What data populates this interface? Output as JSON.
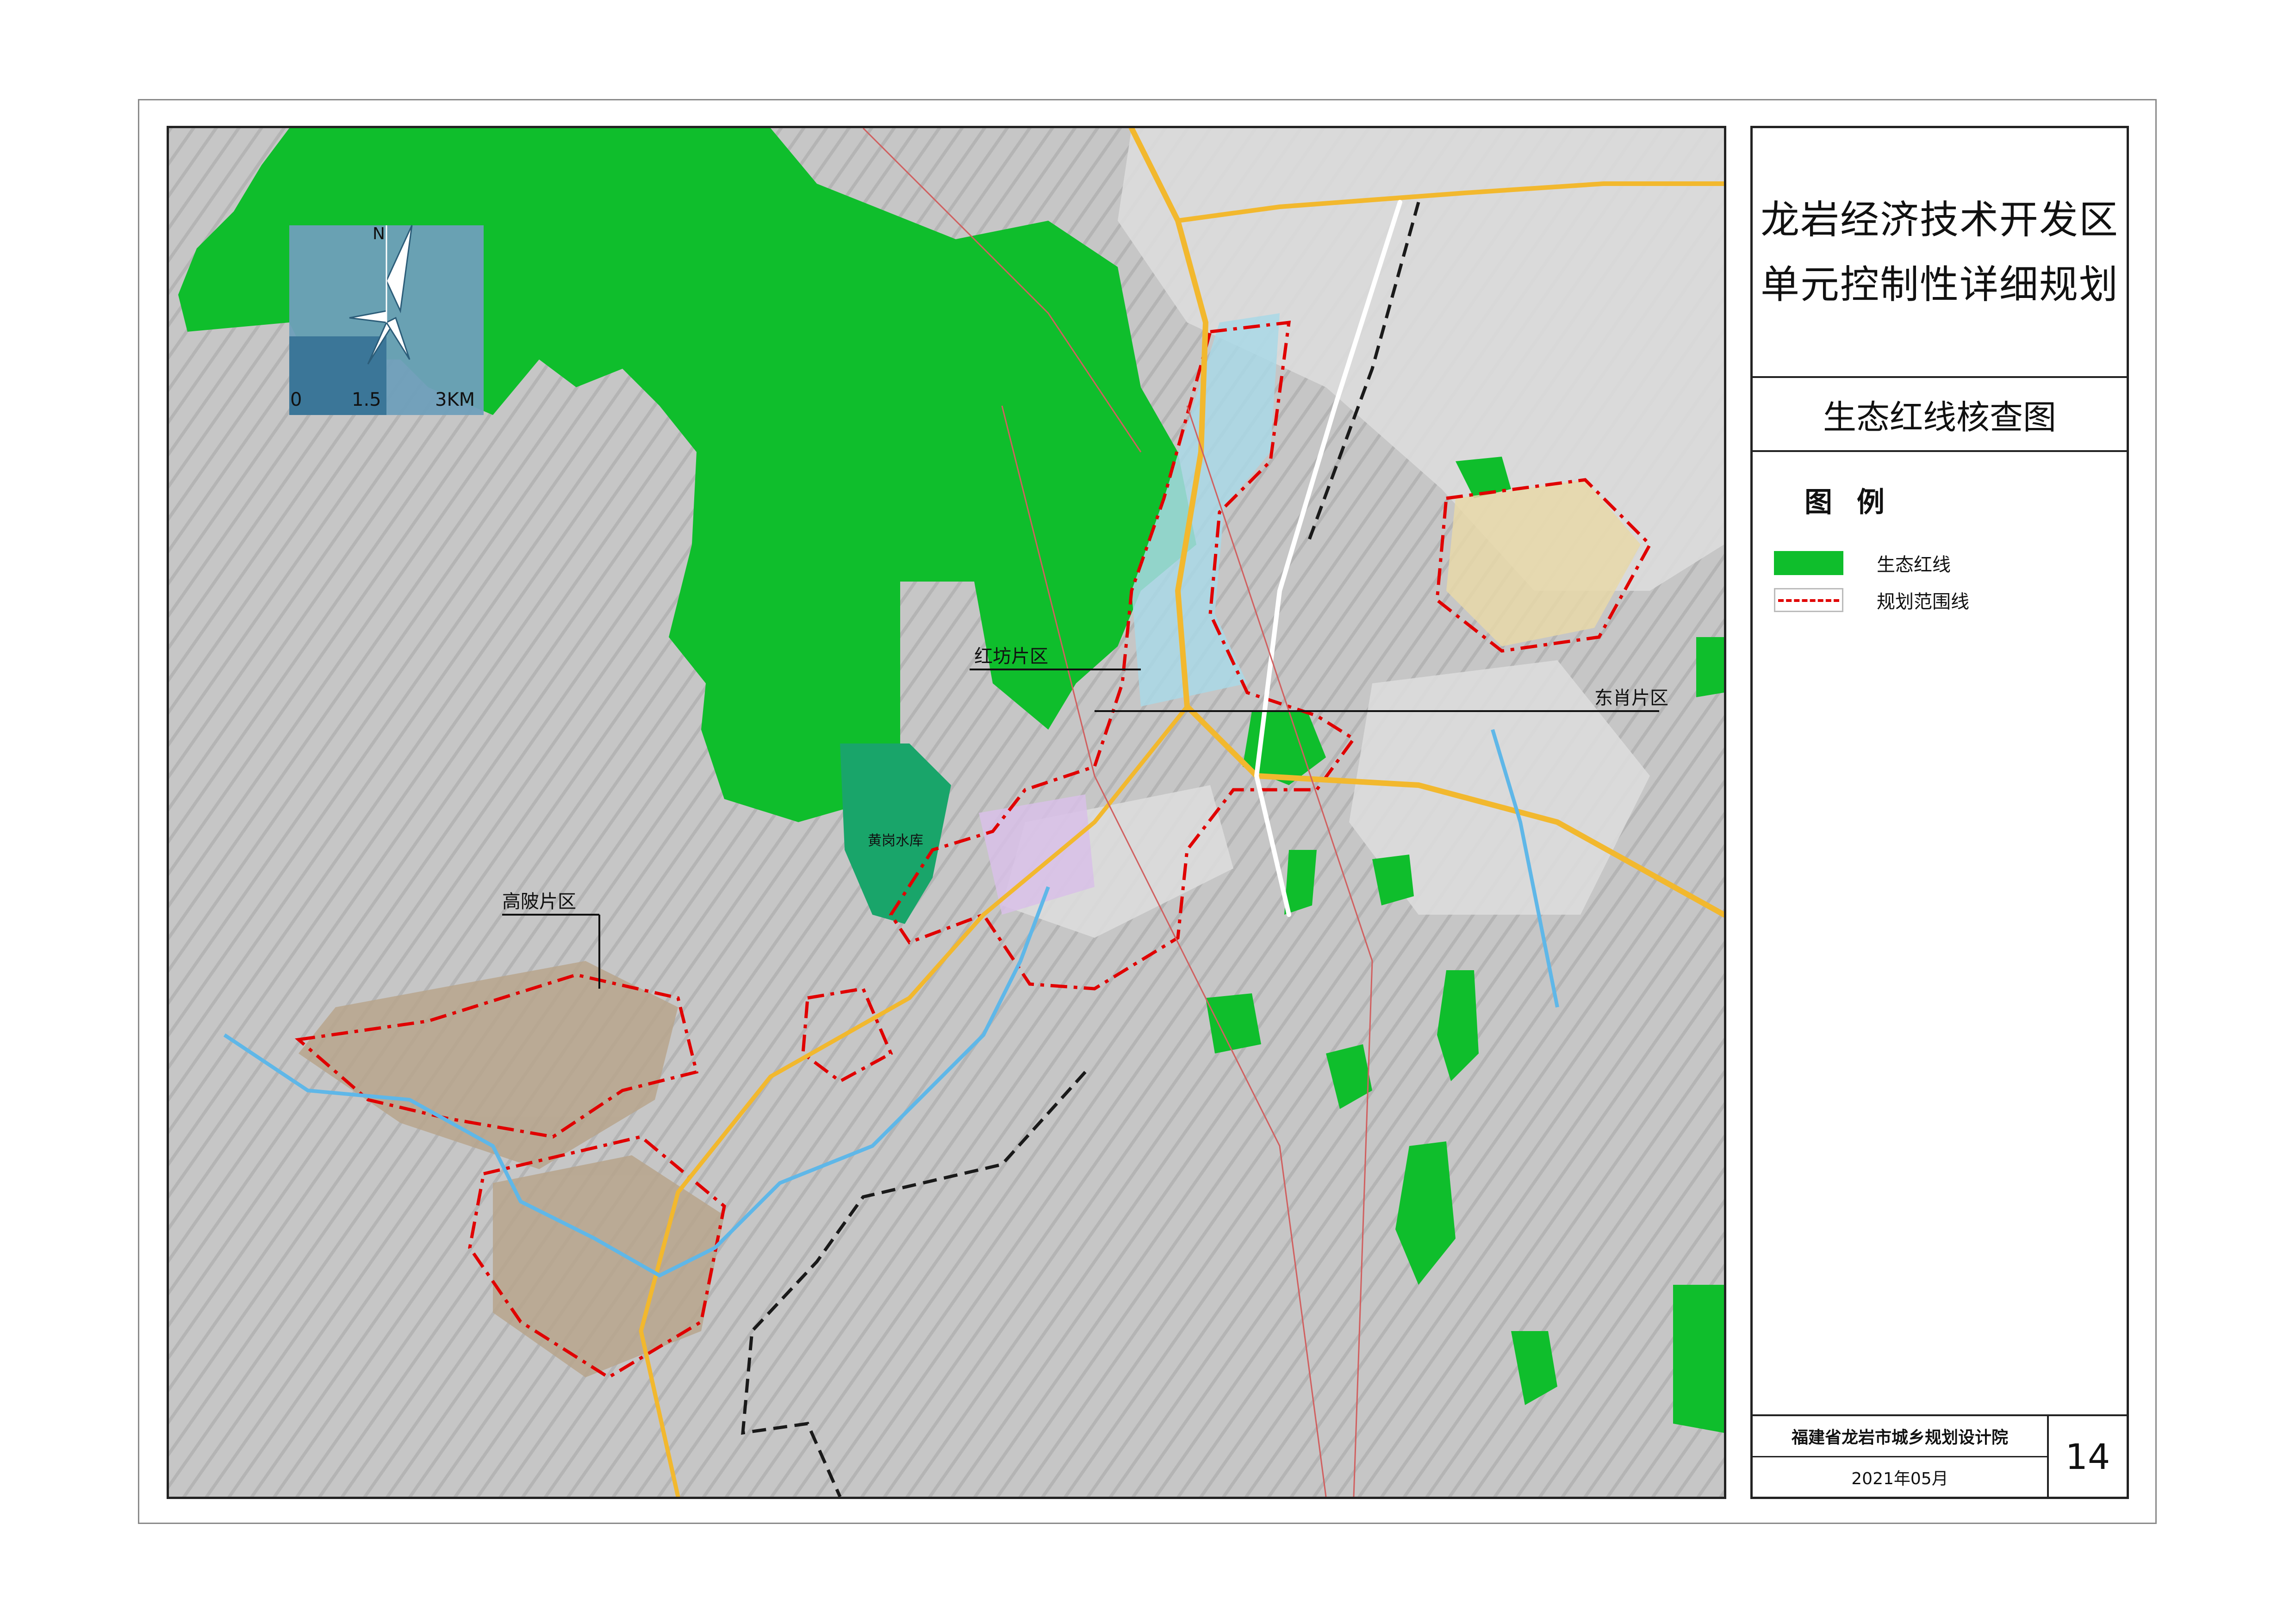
{
  "title": {
    "line1": "龙岩经济技术开发区",
    "line2": "单元控制性详细规划"
  },
  "subtitle": "生态红线核查图",
  "legend": {
    "heading": "图 例",
    "items": [
      {
        "label": "生态红线",
        "color": "#0fbe2c"
      },
      {
        "label": "规划范围线",
        "color": "#e00000"
      }
    ]
  },
  "map": {
    "labels": {
      "hongfang": "红坊片区",
      "dongxiao": "东肖片区",
      "gaopo": "高陂片区",
      "reservoir": "黄岗水库"
    },
    "scale_bar": {
      "ticks": [
        "0",
        "1.5",
        "3KM"
      ]
    },
    "north_label": "N",
    "colors": {
      "ecological_redline": "#0fbe2c",
      "planning_boundary": "#e00000",
      "terrain": "#c9c9c9"
    }
  },
  "footer": {
    "organization": "福建省龙岩市城乡规划设计院",
    "date": "2021年05月",
    "page": "14"
  }
}
